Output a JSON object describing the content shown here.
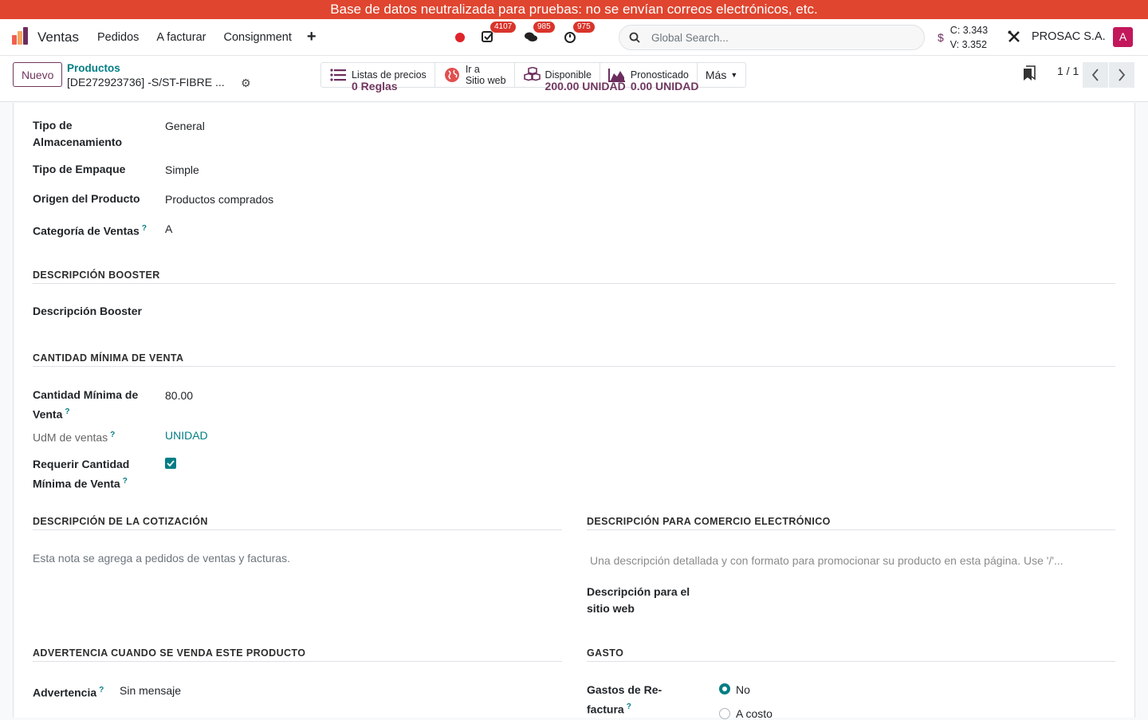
{
  "banner": "Base de datos neutralizada para pruebas: no se envían correos electrónicos, etc.",
  "navbar": {
    "app_name": "Ventas",
    "menu": [
      "Pedidos",
      "A facturar",
      "Consignment"
    ],
    "plus": "+",
    "badges": {
      "activities": "4107",
      "messages": "985",
      "timer": "975"
    },
    "search_placeholder": "Global Search...",
    "currency_symbol": "$",
    "rate_c": "C: 3.343",
    "rate_v": "V: 3.352",
    "company": "PROSAC S.A.",
    "avatar_letter": "A"
  },
  "control": {
    "new_button": "Nuevo",
    "breadcrumb_parent": "Productos",
    "breadcrumb_current": "[DE272923736] -S/ST-FIBRE ...",
    "smart_buttons": [
      {
        "line1": "Listas de precios",
        "line2": "0  Reglas",
        "icon": "list-icon"
      },
      {
        "line1": "Ir a",
        "line2": "Sitio web",
        "icon": "globe-icon"
      },
      {
        "line1": "Disponible",
        "line2": "200.00 UNIDAD",
        "icon": "cubes-icon"
      },
      {
        "line1": "Pronosticado",
        "line2": "0.00 UNIDAD",
        "icon": "area-chart-icon"
      }
    ],
    "more_button": "Más",
    "pager": "1 / 1"
  },
  "form": {
    "storage_type_label": "Tipo de Almacenamiento",
    "storage_type_value": "General",
    "packaging_type_label": "Tipo de Empaque",
    "packaging_type_value": "Simple",
    "origin_label": "Origen del Producto",
    "origin_value": "Productos comprados",
    "sales_category_label": "Categoría de Ventas",
    "sales_category_value": "A",
    "section_booster": "DESCRIPCIÓN BOOSTER",
    "booster_label": "Descripción Booster",
    "section_min_qty": "CANTIDAD MÍNIMA DE VENTA",
    "min_qty_label": "Cantidad Mínima de Venta",
    "min_qty_value": "80.00",
    "uom_label": "UdM de ventas",
    "uom_value": "UNIDAD",
    "require_min_label": "Requerir Cantidad Mínima de Venta",
    "require_min_checked": true,
    "section_quotation": "DESCRIPCIÓN DE LA COTIZACIÓN",
    "quotation_placeholder": "Esta nota se agrega a pedidos de ventas y facturas.",
    "section_ecommerce": "DESCRIPCIÓN PARA COMERCIO ELECTRÓNICO",
    "ecommerce_placeholder": "Una descripción detallada y con formato para promocionar su producto en esta página. Use '/'...",
    "website_desc_label": "Descripción para el sitio web",
    "section_warning": "ADVERTENCIA CUANDO SE VENDA ESTE PRODUCTO",
    "warning_label": "Advertencia",
    "warning_value": "Sin mensaje",
    "section_expense": "GASTO",
    "expense_label": "Gastos de Re-factura",
    "expense_options": [
      "No",
      "A costo"
    ],
    "expense_selected": "No"
  },
  "colors": {
    "banner": "#e0452f",
    "primary": "#71375f",
    "teal": "#017e84"
  }
}
